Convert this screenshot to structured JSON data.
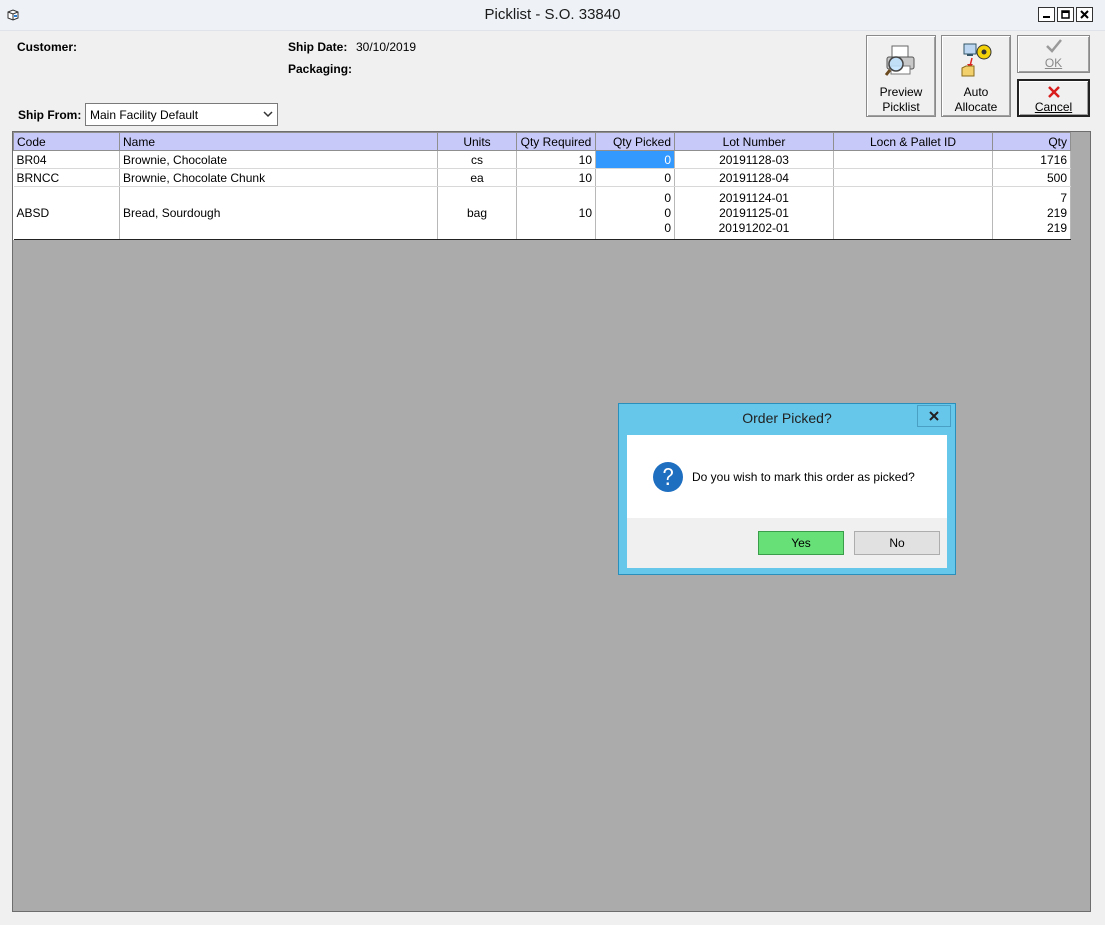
{
  "window": {
    "title": "Picklist - S.O. 33840",
    "app_icon": "box-icon",
    "controls": [
      "minimize-icon",
      "maximize-icon",
      "close-icon"
    ]
  },
  "header": {
    "customer_label": "Customer:",
    "customer_value": "",
    "ship_date_label": "Ship Date:",
    "ship_date_value": "30/10/2019",
    "packaging_label": "Packaging:",
    "packaging_value": "",
    "ship_from_label": "Ship From:",
    "ship_from_value": "Main Facility Default"
  },
  "toolbar": {
    "preview": {
      "line1": "Preview",
      "line2": "Picklist",
      "icon": "printer-magnifier-icon"
    },
    "auto_allocate": {
      "line1": "Auto",
      "line2": "Allocate",
      "icon": "auto-allocate-icon"
    },
    "ok": {
      "label": "OK",
      "icon": "checkmark-icon",
      "enabled": false
    },
    "cancel": {
      "label": "Cancel",
      "icon": "red-x-icon"
    }
  },
  "table": {
    "columns": [
      "Code",
      "Name",
      "Units",
      "Qty Required",
      "Qty Picked",
      "Lot Number",
      "Locn & Pallet ID",
      "Qty"
    ],
    "rows": [
      {
        "code": "BR04",
        "name": "Brownie, Chocolate",
        "units": "cs",
        "qty_required": "10",
        "qty_picked": [
          "0"
        ],
        "lot_number": [
          "20191128-03"
        ],
        "locn": "",
        "qty": [
          "1716"
        ]
      },
      {
        "code": "BRNCC",
        "name": "Brownie, Chocolate Chunk",
        "units": "ea",
        "qty_required": "10",
        "qty_picked": [
          "0"
        ],
        "lot_number": [
          "20191128-04"
        ],
        "locn": "",
        "qty": [
          "500"
        ]
      },
      {
        "code": "ABSD",
        "name": "Bread, Sourdough",
        "units": "bag",
        "qty_required": "10",
        "qty_picked": [
          "0",
          "0",
          "0"
        ],
        "lot_number": [
          "20191124-01",
          "20191125-01",
          "20191202-01"
        ],
        "locn": "",
        "qty": [
          "7",
          "219",
          "219"
        ]
      }
    ],
    "selection_color": "#3399ff",
    "header_color": "#c7c9f8"
  },
  "dialog": {
    "title": "Order Picked?",
    "message": "Do you wish to mark this order as picked?",
    "icon": "question-icon",
    "yes_label": "Yes",
    "no_label": "No",
    "accent_color": "#66c7ea",
    "yes_color": "#66e077"
  }
}
